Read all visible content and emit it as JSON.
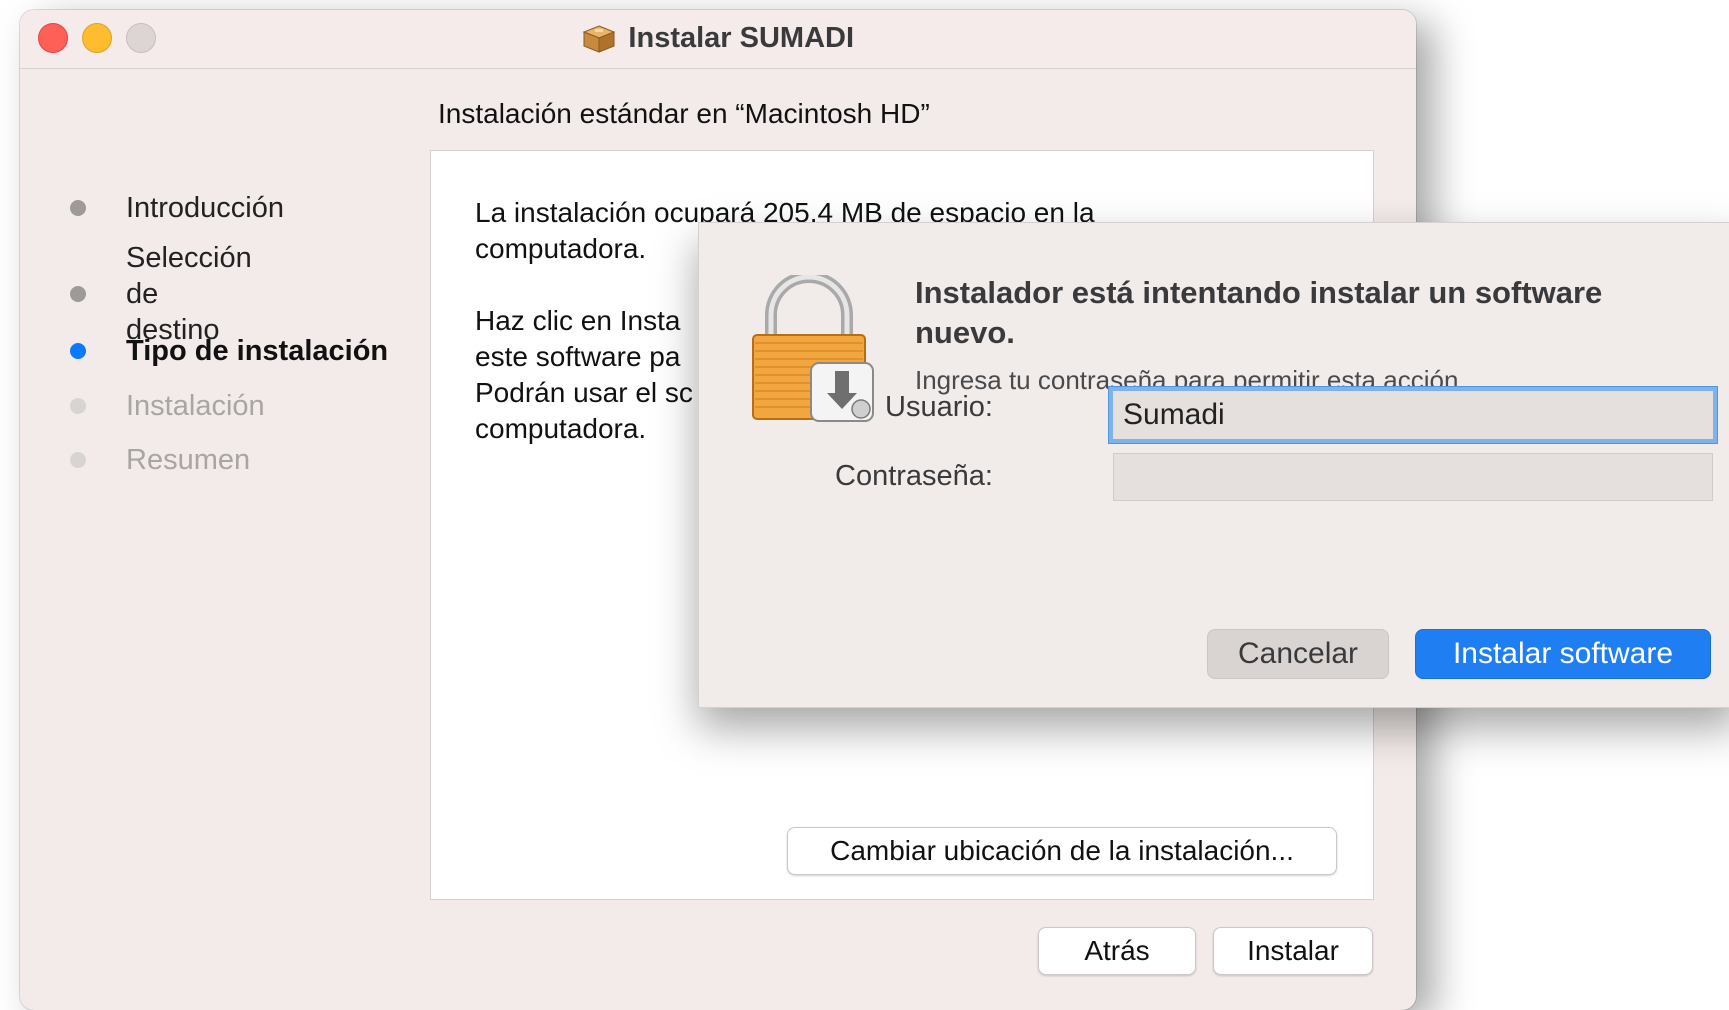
{
  "window": {
    "title": "Instalar SUMADI",
    "heading": "Instalación estándar en “Macintosh HD”"
  },
  "sidebar": {
    "steps": [
      {
        "label": "Introducción",
        "state": "done"
      },
      {
        "label": "Selección\nde destino",
        "state": "done"
      },
      {
        "label": "Tipo de instalación",
        "state": "active"
      },
      {
        "label": "Instalación",
        "state": "pending"
      },
      {
        "label": "Resumen",
        "state": "pending"
      }
    ]
  },
  "content": {
    "paragraph1": "La instalación ocupará 205.4 MB de espacio en la\ncomputadora.",
    "paragraph2": "Haz clic en Insta\neste software pa\nPodrán usar el sc\ncomputadora.",
    "change_location_button": "Cambiar ubicación de la instalación..."
  },
  "footer": {
    "back_button": "Atrás",
    "install_button": "Instalar"
  },
  "dialog": {
    "title": "Instalador está intentando instalar un software nuevo.",
    "subtitle": "Ingresa tu contraseña para permitir esta acción.",
    "user_label": "Usuario:",
    "user_value": "Sumadi",
    "password_label": "Contraseña:",
    "password_value": "",
    "cancel_button": "Cancelar",
    "confirm_button": "Instalar software"
  },
  "colors": {
    "accent": "#1f7ff2",
    "active_step": "#0a7aff",
    "close": "#fe5f57",
    "minimize": "#febc2e"
  },
  "icons": {
    "title_icon": "package-icon",
    "dialog_icon": "lock-with-disk-icon"
  }
}
